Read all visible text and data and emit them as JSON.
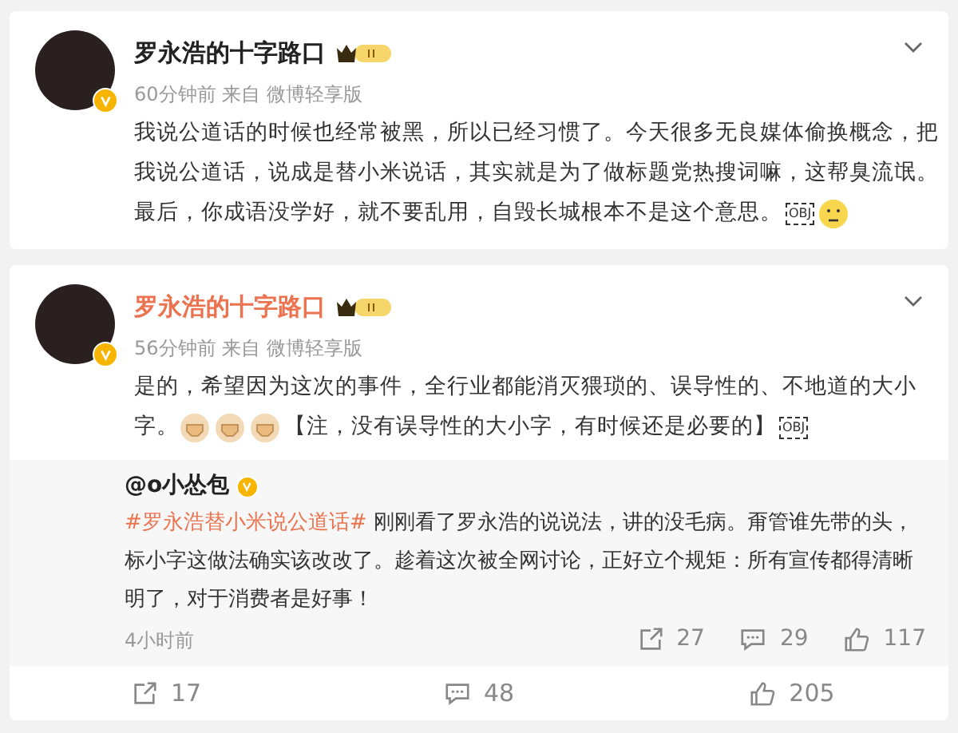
{
  "posts": [
    {
      "author": "罗永浩的十字路口",
      "name_highlighted": false,
      "meta": "60分钟前 来自 微博轻享版",
      "lines": [
        [
          {
            "kind": "text",
            "text": "我说公道话的时候也经常被黑，所以已经习惯了。今天很多无良媒体偷换概念，把"
          }
        ],
        [
          {
            "kind": "text",
            "text": "我说公道话，说成是替小米说话，其实就是为了做标题党热搜词嘛，这帮臭流氓。"
          }
        ],
        [
          {
            "kind": "text",
            "text": "最后，你成语没学好，就不要乱用，自毁长城根本不是这个意思。"
          },
          {
            "kind": "obj",
            "text": "OBJ"
          },
          {
            "kind": "face"
          }
        ]
      ]
    },
    {
      "author": "罗永浩的十字路口",
      "name_highlighted": true,
      "meta": "56分钟前 来自 微博轻享版",
      "lines": [
        [
          {
            "kind": "text",
            "text": "是的，希望因为这次的事件，全行业都能消灭猥琐的、误导性的、不地道的大小"
          }
        ],
        [
          {
            "kind": "text",
            "text": "字。"
          },
          {
            "kind": "fist"
          },
          {
            "kind": "fist"
          },
          {
            "kind": "fist"
          },
          {
            "kind": "text",
            "text": "【注，没有误导性的大小字，有时候还是必要的】"
          },
          {
            "kind": "obj",
            "text": "OBJ"
          }
        ]
      ],
      "repost": {
        "author": "@o小怂包",
        "hashtag": "#罗永浩替小米说公道话#",
        "text": "刚刚看了罗永浩的说说法，讲的没毛病。甭管谁先带的头，标小字这做法确实该改改了。趁着这次被全网讨论，正好立个规矩：所有宣传都得清晰明了，对于消费者是好事！",
        "time": "4小时前",
        "shares": "27",
        "comments": "29",
        "likes": "117"
      },
      "actions": {
        "shares": "17",
        "comments": "48",
        "likes": "205"
      }
    }
  ]
}
